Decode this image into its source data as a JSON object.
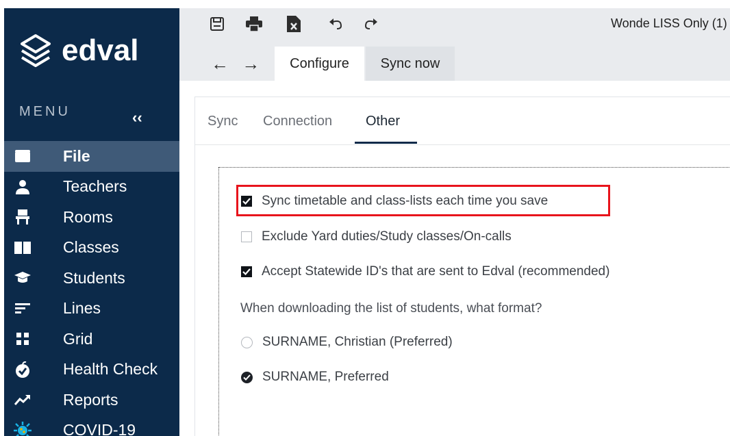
{
  "app": {
    "window_title": "Wonde LISS Only (1)",
    "logo_text": "edval"
  },
  "sidebar": {
    "menu_label": "MENU",
    "collapse_label": "‹‹",
    "items": [
      {
        "label": "File",
        "icon": "folder-icon",
        "active": true
      },
      {
        "label": "Teachers",
        "icon": "person-icon"
      },
      {
        "label": "Rooms",
        "icon": "chair-icon"
      },
      {
        "label": "Classes",
        "icon": "book-icon"
      },
      {
        "label": "Students",
        "icon": "graduation-cap-icon"
      },
      {
        "label": "Lines",
        "icon": "lines-icon"
      },
      {
        "label": "Grid",
        "icon": "grid-icon"
      },
      {
        "label": "Health Check",
        "icon": "apple-check-icon"
      },
      {
        "label": "Reports",
        "icon": "trend-icon"
      },
      {
        "label": "COVID-19",
        "icon": "virus-icon"
      }
    ]
  },
  "toolbar": {
    "icons": [
      "save-icon",
      "print-icon",
      "excel-icon",
      "undo-icon",
      "redo-icon"
    ],
    "back_forward": "← →"
  },
  "top_tabs": {
    "configure": "Configure",
    "sync_now": "Sync now"
  },
  "sub_tabs": {
    "sync": "Sync",
    "connection": "Connection",
    "other": "Other"
  },
  "options": {
    "sync_each_save": {
      "label": "Sync timetable and class-lists each time you save",
      "checked": true
    },
    "exclude_yard": {
      "label": "Exclude Yard duties/Study classes/On-calls",
      "checked": false
    },
    "accept_statewide": {
      "label": "Accept Statewide ID's that are sent to Edval (recommended)",
      "checked": true
    },
    "format_question": "When downloading the list of students, what format?",
    "format_options": [
      {
        "label": "SURNAME, Christian (Preferred)",
        "selected": false
      },
      {
        "label": "SURNAME, Preferred",
        "selected": true
      }
    ]
  },
  "colors": {
    "sidebar_bg": "#0c2a4a",
    "sidebar_active": "#3f5a78",
    "highlight": "#e8141c",
    "covid_icon": "#19b3e6"
  }
}
